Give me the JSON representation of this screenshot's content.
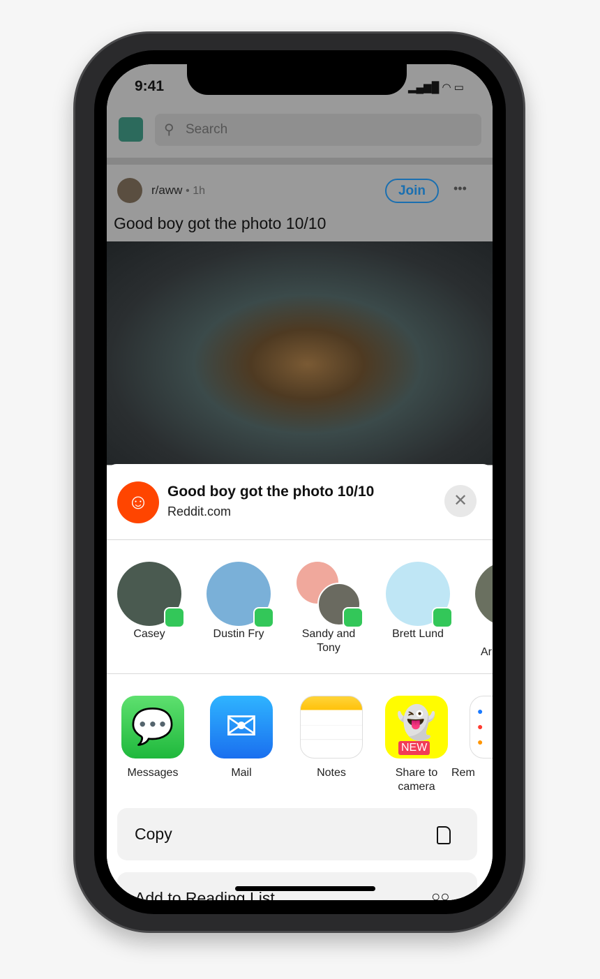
{
  "status": {
    "time": "9:41"
  },
  "header": {
    "search_placeholder": "Search"
  },
  "post": {
    "subreddit": "r/aww",
    "age": "• 1h",
    "join_label": "Join",
    "title": "Good boy got the photo 10/10"
  },
  "share": {
    "title": "Good boy got the photo 10/10",
    "source": "Reddit.com",
    "people": [
      {
        "name": "Casey"
      },
      {
        "name": "Dustin Fry"
      },
      {
        "name": "Sandy and Tony"
      },
      {
        "name": "Brett Lund"
      },
      {
        "name": "Ar"
      }
    ],
    "apps": [
      {
        "name": "Messages"
      },
      {
        "name": "Mail"
      },
      {
        "name": "Notes"
      },
      {
        "name": "Share to camera",
        "badge": "NEW"
      },
      {
        "name": "Rem"
      }
    ],
    "actions": [
      {
        "label": "Copy",
        "icon": "document-icon"
      },
      {
        "label": "Add to Reading List",
        "icon": "glasses-icon"
      }
    ]
  },
  "colors": {
    "reddit": "#ff4500",
    "join": "#1a6fb0",
    "messages": "#33c759",
    "snapchat": "#fffc00"
  }
}
